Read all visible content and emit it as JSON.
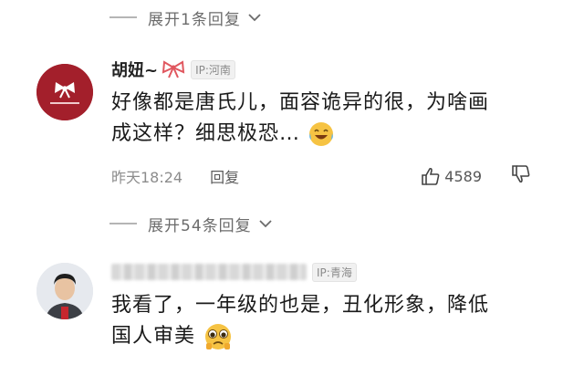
{
  "top_expand": {
    "label": "展开1条回复"
  },
  "comment1": {
    "username": "胡妞~",
    "bow_icon": "bow-icon",
    "ip_label": "IP:河南",
    "content_line1": "好像都是唐氏儿，面容诡异的很，为啥画",
    "content_line2": "成这样？细思极恐…",
    "emoji": "laughing-crying-emoji",
    "time": "昨天18:24",
    "reply_label": "回复",
    "likes": "4589"
  },
  "mid_expand": {
    "label": "展开54条回复"
  },
  "comment2": {
    "ip_label": "IP:青海",
    "content_line1": "我看了，一年级的也是，丑化形象，降低",
    "content_line2": "国人审美",
    "emoji": "pleading-emoji"
  },
  "colors": {
    "text": "#1a1a1a",
    "muted": "#8c8c8c",
    "avatar1_bg": "#a31f2b",
    "bow": "#e0575f",
    "emoji_yellow": "#f6c343"
  }
}
